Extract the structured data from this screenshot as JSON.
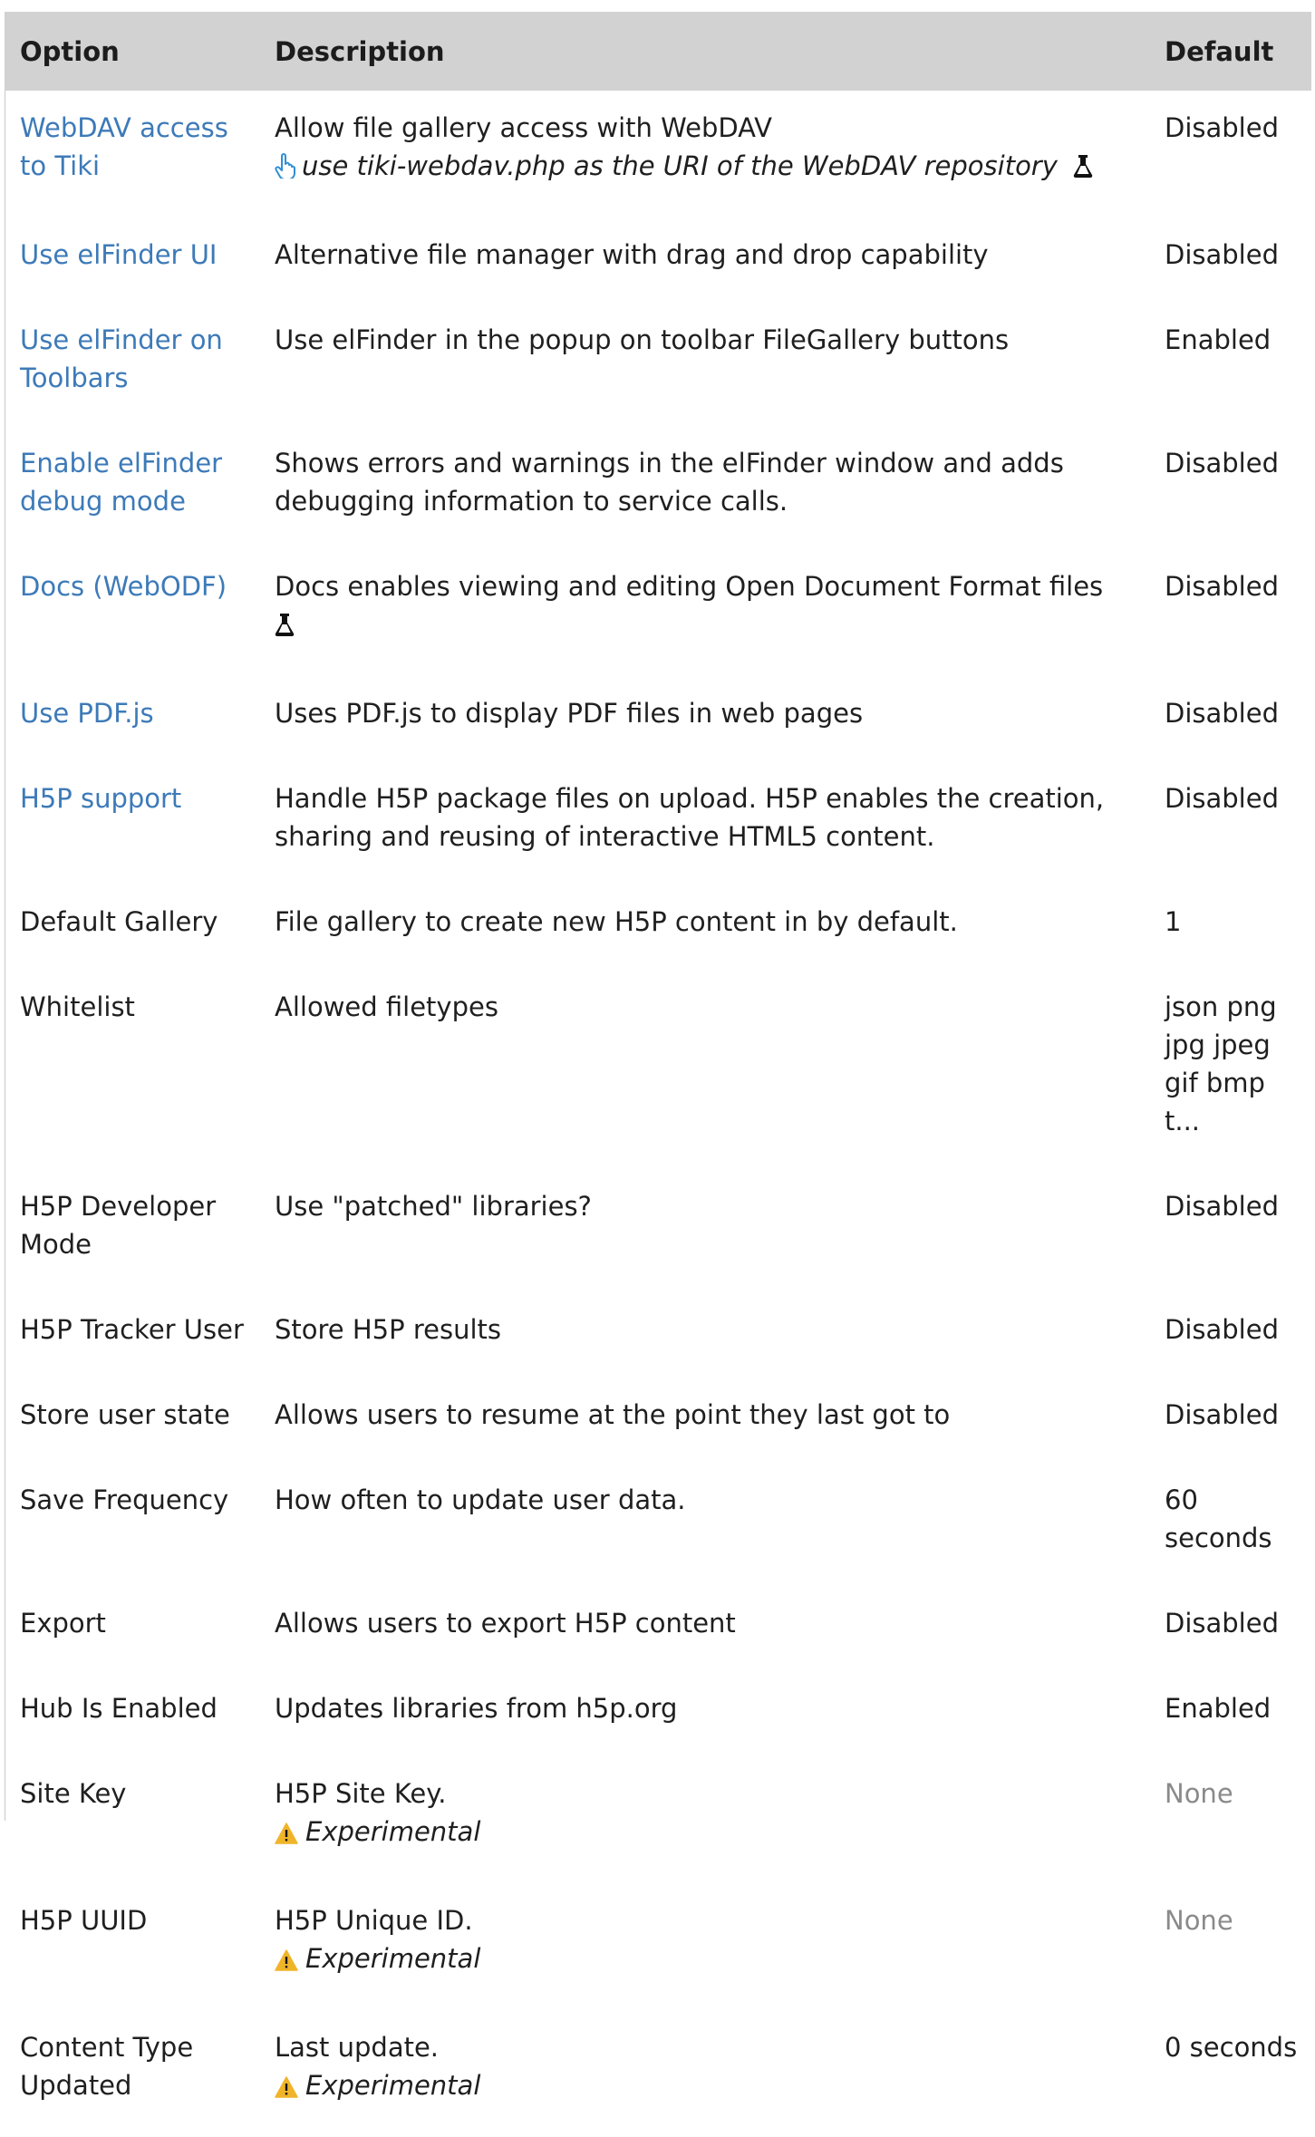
{
  "header": {
    "option": "Option",
    "description": "Description",
    "default": "Default"
  },
  "rows": [
    {
      "option": "WebDAV access to Tiki",
      "link": true,
      "description": "Allow file gallery access with WebDAV",
      "note": "use tiki-webdav.php as the URI of the WebDAV repository",
      "default": "Disabled"
    },
    {
      "option": "Use elFinder UI",
      "link": true,
      "description": "Alternative file manager with drag and drop capability",
      "default": "Disabled"
    },
    {
      "option": "Use elFinder on Toolbars",
      "link": true,
      "description": "Use elFinder in the popup on toolbar FileGallery buttons",
      "default": "Enabled"
    },
    {
      "option": "Enable elFinder debug mode",
      "link": true,
      "description": "Shows errors and warnings in the elFinder window and adds debugging information to service calls.",
      "default": "Disabled"
    },
    {
      "option": "Docs (WebODF)",
      "link": true,
      "description": "Docs enables viewing and editing Open Document Format files",
      "default": "Disabled"
    },
    {
      "option": "Use PDF.js",
      "link": true,
      "description": "Uses PDF.js to display PDF files in web pages",
      "default": "Disabled"
    },
    {
      "option": "H5P support",
      "link": true,
      "description": "Handle H5P package files on upload. H5P enables the creation, sharing and reusing of interactive HTML5 content.",
      "default": "Disabled"
    },
    {
      "option": "Default Gallery",
      "description": "File gallery to create new H5P content in by default.",
      "default": "1"
    },
    {
      "option": "Whitelist",
      "description": "Allowed filetypes",
      "default": "json png jpg jpeg gif bmp t..."
    },
    {
      "option": "H5P Developer Mode",
      "description": "Use \"patched\" libraries?",
      "default": "Disabled"
    },
    {
      "option": "H5P Tracker User",
      "description": "Store H5P results",
      "default": "Disabled"
    },
    {
      "option": "Store user state",
      "description": "Allows users to resume at the point they last got to",
      "default": "Disabled"
    },
    {
      "option": "Save Frequency",
      "description": "How often to update user data.",
      "default": "60 seconds"
    },
    {
      "option": "Export",
      "description": "Allows users to export H5P content",
      "default": "Disabled"
    },
    {
      "option": "Hub Is Enabled",
      "description": "Updates libraries from h5p.org",
      "default": "Enabled"
    },
    {
      "option": "Site Key",
      "description": "H5P Site Key.",
      "note": "Experimental",
      "default": "None"
    },
    {
      "option": "H5P UUID",
      "description": "H5P Unique ID.",
      "note": "Experimental",
      "default": "None"
    },
    {
      "option": "Content Type Updated",
      "description": "Last update.",
      "note": "Experimental",
      "default": "0 seconds"
    }
  ],
  "icons": {
    "hand": "pointing-hand-icon",
    "flask": "flask-icon",
    "warning": "warning-icon"
  },
  "colors": {
    "link": "#3d7ab8",
    "header_bg": "#d2d2d2",
    "warning": "#f0b429",
    "muted": "#8a8a8a"
  }
}
